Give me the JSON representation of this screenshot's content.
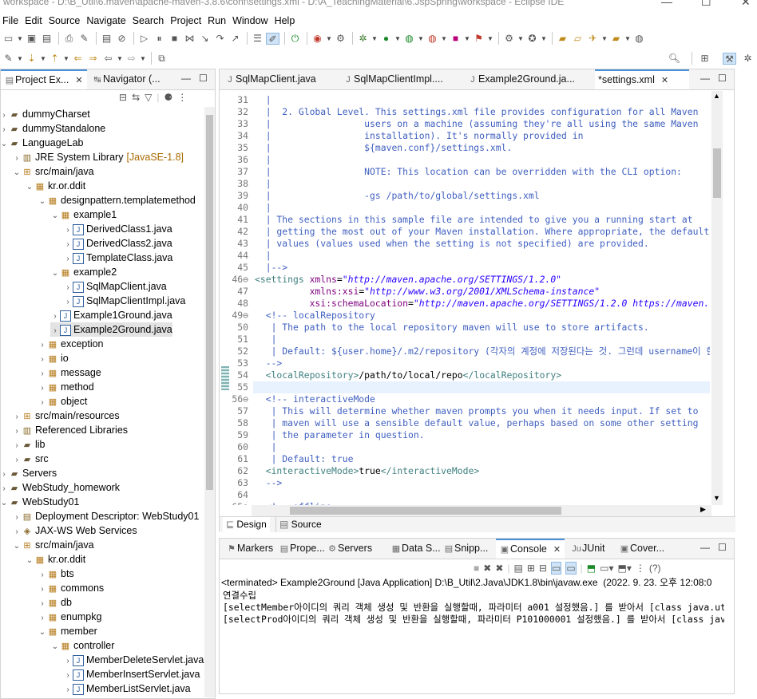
{
  "window": {
    "title": "workspace - D:\\B_Util\\6.maven\\apache-maven-3.8.6\\conf\\settings.xml - D:\\A_TeachingMaterial\\6.JspSpring\\workspace - Eclipse IDE"
  },
  "menu": [
    "File",
    "Edit",
    "Source",
    "Navigate",
    "Search",
    "Project",
    "Run",
    "Window",
    "Help"
  ],
  "left_tabs": [
    {
      "label": "Project Ex...",
      "close": "✕"
    },
    {
      "label": "Navigator (...",
      "close": ""
    }
  ],
  "tree": [
    {
      "label": "dummyCharset",
      "level": 0,
      "tw": "›",
      "icon": "folder",
      "kind": "proj"
    },
    {
      "label": "dummyStandalone",
      "level": 0,
      "tw": "›",
      "icon": "folder",
      "kind": "proj"
    },
    {
      "label": "LanguageLab",
      "level": 0,
      "tw": "⌄",
      "icon": "folder",
      "kind": "proj"
    },
    {
      "label": "JRE System Library",
      "decor": "[JavaSE-1.8]",
      "level": 1,
      "tw": "›",
      "icon": "lib",
      "kind": "lib"
    },
    {
      "label": "src/main/java",
      "level": 1,
      "tw": "⌄",
      "icon": "srcfolder",
      "kind": "pkg"
    },
    {
      "label": "kr.or.ddit",
      "level": 2,
      "tw": "⌄",
      "icon": "package",
      "kind": "pkg"
    },
    {
      "label": "designpattern.templatemethod",
      "level": 3,
      "tw": "⌄",
      "icon": "package",
      "kind": "pkg"
    },
    {
      "label": "example1",
      "level": 4,
      "tw": "⌄",
      "icon": "package",
      "kind": "pkg"
    },
    {
      "label": "DerivedClass1.java",
      "level": 5,
      "tw": "›",
      "icon": "java",
      "kind": "java"
    },
    {
      "label": "DerivedClass2.java",
      "level": 5,
      "tw": "›",
      "icon": "java",
      "kind": "java"
    },
    {
      "label": "TemplateClass.java",
      "level": 5,
      "tw": "›",
      "icon": "java",
      "kind": "java"
    },
    {
      "label": "example2",
      "level": 4,
      "tw": "⌄",
      "icon": "package",
      "kind": "pkg"
    },
    {
      "label": "SqlMapClient.java",
      "level": 5,
      "tw": "›",
      "icon": "java",
      "kind": "java"
    },
    {
      "label": "SqlMapClientImpl.java",
      "level": 5,
      "tw": "›",
      "icon": "java",
      "kind": "java"
    },
    {
      "label": "Example1Ground.java",
      "level": 4,
      "tw": "›",
      "icon": "java",
      "kind": "java"
    },
    {
      "label": "Example2Ground.java",
      "level": 4,
      "tw": "›",
      "icon": "java",
      "kind": "java",
      "selected": true
    },
    {
      "label": "exception",
      "level": 3,
      "tw": "›",
      "icon": "package",
      "kind": "pkg"
    },
    {
      "label": "io",
      "level": 3,
      "tw": "›",
      "icon": "package",
      "kind": "pkg"
    },
    {
      "label": "message",
      "level": 3,
      "tw": "›",
      "icon": "package",
      "kind": "pkg"
    },
    {
      "label": "method",
      "level": 3,
      "tw": "›",
      "icon": "package",
      "kind": "pkg"
    },
    {
      "label": "object",
      "level": 3,
      "tw": "›",
      "icon": "package",
      "kind": "pkg"
    },
    {
      "label": "src/main/resources",
      "level": 1,
      "tw": "›",
      "icon": "srcfolder",
      "kind": "pkg"
    },
    {
      "label": "Referenced Libraries",
      "level": 1,
      "tw": "›",
      "icon": "lib",
      "kind": "lib"
    },
    {
      "label": "lib",
      "level": 1,
      "tw": "›",
      "icon": "folder",
      "kind": "proj"
    },
    {
      "label": "src",
      "level": 1,
      "tw": "›",
      "icon": "folder",
      "kind": "proj"
    },
    {
      "label": "Servers",
      "level": 0,
      "tw": "›",
      "icon": "folder",
      "kind": "proj"
    },
    {
      "label": "WebStudy_homework",
      "level": 0,
      "tw": "›",
      "icon": "folder",
      "kind": "proj"
    },
    {
      "label": "WebStudy01",
      "level": 0,
      "tw": "⌄",
      "icon": "folder",
      "kind": "proj"
    },
    {
      "label": "Deployment Descriptor: WebStudy01",
      "level": 1,
      "tw": "›",
      "icon": "dd",
      "kind": "lib"
    },
    {
      "label": "JAX-WS Web Services",
      "level": 1,
      "tw": "›",
      "icon": "ws",
      "kind": "lib"
    },
    {
      "label": "src/main/java",
      "level": 1,
      "tw": "⌄",
      "icon": "srcfolder",
      "kind": "pkg"
    },
    {
      "label": "kr.or.ddit",
      "level": 2,
      "tw": "⌄",
      "icon": "package",
      "kind": "pkg"
    },
    {
      "label": "bts",
      "level": 3,
      "tw": "›",
      "icon": "package",
      "kind": "pkg"
    },
    {
      "label": "commons",
      "level": 3,
      "tw": "›",
      "icon": "package",
      "kind": "pkg"
    },
    {
      "label": "db",
      "level": 3,
      "tw": "›",
      "icon": "package",
      "kind": "pkg"
    },
    {
      "label": "enumpkg",
      "level": 3,
      "tw": "›",
      "icon": "package",
      "kind": "pkg"
    },
    {
      "label": "member",
      "level": 3,
      "tw": "⌄",
      "icon": "package",
      "kind": "pkg"
    },
    {
      "label": "controller",
      "level": 4,
      "tw": "⌄",
      "icon": "package",
      "kind": "pkg"
    },
    {
      "label": "MemberDeleteServlet.java",
      "level": 5,
      "tw": "›",
      "icon": "java",
      "kind": "java"
    },
    {
      "label": "MemberInsertServlet.java",
      "level": 5,
      "tw": "›",
      "icon": "java",
      "kind": "java"
    },
    {
      "label": "MemberListServlet.java",
      "level": 5,
      "tw": "›",
      "icon": "java",
      "kind": "java"
    }
  ],
  "editor_tabs": [
    {
      "label": "SqlMapClient.java",
      "active": false
    },
    {
      "label": "SqlMapClientImpl....",
      "active": false
    },
    {
      "label": "Example2Ground.ja...",
      "active": false
    },
    {
      "label": "*settings.xml",
      "active": true
    }
  ],
  "code_lines": [
    {
      "n": "31",
      "segs": [
        {
          "t": "  |",
          "c": "cm"
        }
      ]
    },
    {
      "n": "32",
      "segs": [
        {
          "t": "  |  2. Global Level. This settings.xml file provides configuration for all Maven",
          "c": "cm"
        }
      ]
    },
    {
      "n": "33",
      "segs": [
        {
          "t": "  |                 users on a machine (assuming they're all using the same Maven",
          "c": "cm"
        }
      ]
    },
    {
      "n": "34",
      "segs": [
        {
          "t": "  |                 installation). It's normally provided in",
          "c": "cm"
        }
      ]
    },
    {
      "n": "35",
      "segs": [
        {
          "t": "  |                 ${maven.conf}/settings.xml.",
          "c": "cm"
        }
      ]
    },
    {
      "n": "36",
      "segs": [
        {
          "t": "  |",
          "c": "cm"
        }
      ]
    },
    {
      "n": "37",
      "segs": [
        {
          "t": "  |                 NOTE: This location can be overridden with the CLI option:",
          "c": "cm"
        }
      ]
    },
    {
      "n": "38",
      "segs": [
        {
          "t": "  |",
          "c": "cm"
        }
      ]
    },
    {
      "n": "39",
      "segs": [
        {
          "t": "  |                 -gs /path/to/global/settings.xml",
          "c": "cm"
        }
      ]
    },
    {
      "n": "40",
      "segs": [
        {
          "t": "  |",
          "c": "cm"
        }
      ]
    },
    {
      "n": "41",
      "segs": [
        {
          "t": "  | The sections in this sample file are intended to give you a running start at",
          "c": "cm"
        }
      ]
    },
    {
      "n": "42",
      "segs": [
        {
          "t": "  | getting the most out of your Maven installation. Where appropriate, the default",
          "c": "cm"
        }
      ]
    },
    {
      "n": "43",
      "segs": [
        {
          "t": "  | values (values used when the setting is not specified) are provided.",
          "c": "cm"
        }
      ]
    },
    {
      "n": "44",
      "segs": [
        {
          "t": "  |",
          "c": "cm"
        }
      ]
    },
    {
      "n": "45",
      "segs": [
        {
          "t": "  |-->",
          "c": "cm"
        }
      ]
    },
    {
      "n": "46⊖",
      "segs": [
        {
          "t": "<settings ",
          "c": "tg"
        },
        {
          "t": "xmlns",
          "c": "at"
        },
        {
          "t": "=",
          "c": ""
        },
        {
          "t": "\"http://maven.apache.org/SETTINGS/1.2.0\"",
          "c": "av"
        }
      ]
    },
    {
      "n": "47",
      "segs": [
        {
          "t": "          ",
          "c": ""
        },
        {
          "t": "xmlns:xsi",
          "c": "at"
        },
        {
          "t": "=",
          "c": ""
        },
        {
          "t": "\"http://www.w3.org/2001/XMLSchema-instance\"",
          "c": "av"
        }
      ]
    },
    {
      "n": "48",
      "segs": [
        {
          "t": "          ",
          "c": ""
        },
        {
          "t": "xsi:schemaLocation",
          "c": "at"
        },
        {
          "t": "=",
          "c": ""
        },
        {
          "t": "\"http://maven.apache.org/SETTINGS/1.2.0 https://maven.",
          "c": "av"
        }
      ]
    },
    {
      "n": "49⊖",
      "segs": [
        {
          "t": "  <!-- localRepository",
          "c": "cm"
        }
      ]
    },
    {
      "n": "50",
      "segs": [
        {
          "t": "   | The path to the local repository maven will use to store artifacts.",
          "c": "cm"
        }
      ]
    },
    {
      "n": "51",
      "segs": [
        {
          "t": "   |",
          "c": "cm"
        }
      ]
    },
    {
      "n": "52",
      "segs": [
        {
          "t": "   | Default: ${user.home}/.m2/repository (각자의 계정에 저장된다는 것. 그런데 username이 한",
          "c": "cm"
        }
      ]
    },
    {
      "n": "53",
      "segs": [
        {
          "t": "  -->",
          "c": "cm"
        }
      ]
    },
    {
      "n": "54",
      "segs": [
        {
          "t": "  <localRepository>",
          "c": "tg"
        },
        {
          "t": "/path/to/local/repo",
          "c": ""
        },
        {
          "t": "</localRepository>",
          "c": "tg"
        }
      ]
    },
    {
      "n": "55",
      "segs": [
        {
          "t": "",
          "c": ""
        }
      ],
      "current": true
    },
    {
      "n": "56⊖",
      "segs": [
        {
          "t": "  <!-- interactiveMode",
          "c": "cm"
        }
      ]
    },
    {
      "n": "57",
      "segs": [
        {
          "t": "   | This will determine whether maven prompts you when it needs input. If set to",
          "c": "cm"
        }
      ]
    },
    {
      "n": "58",
      "segs": [
        {
          "t": "   | maven will use a sensible default value, perhaps based on some other setting",
          "c": "cm"
        }
      ]
    },
    {
      "n": "59",
      "segs": [
        {
          "t": "   | the parameter in question.",
          "c": "cm"
        }
      ]
    },
    {
      "n": "60",
      "segs": [
        {
          "t": "   |",
          "c": "cm"
        }
      ]
    },
    {
      "n": "61",
      "segs": [
        {
          "t": "   | Default: true",
          "c": "cm"
        }
      ]
    },
    {
      "n": "62",
      "segs": [
        {
          "t": "  <interactiveMode>",
          "c": "tg"
        },
        {
          "t": "true",
          "c": ""
        },
        {
          "t": "</interactiveMode>",
          "c": "tg"
        }
      ]
    },
    {
      "n": "63",
      "segs": [
        {
          "t": "  -->",
          "c": "cm"
        }
      ]
    },
    {
      "n": "64",
      "segs": [
        {
          "t": "",
          "c": ""
        }
      ]
    },
    {
      "n": "65⊖",
      "segs": [
        {
          "t": "  <!-- offline",
          "c": "cm"
        }
      ]
    }
  ],
  "design_tabs": {
    "design": "Design",
    "source": "Source"
  },
  "bottom_tabs": [
    {
      "label": "Markers",
      "active": false
    },
    {
      "label": "Prope...",
      "active": false
    },
    {
      "label": "Servers",
      "active": false
    },
    {
      "label": "Data S...",
      "active": false
    },
    {
      "label": "Snipp...",
      "active": false
    },
    {
      "label": "Console",
      "active": true
    },
    {
      "label": "JUnit",
      "active": false
    },
    {
      "label": "Cover...",
      "active": false
    }
  ],
  "console": {
    "terminated": "<terminated> Example2Ground [Java Application] D:\\B_Util\\2.Java\\JDK1.8\\bin\\javaw.exe  (2022. 9. 23. 오후 12:08:0",
    "lines": [
      "연결수립",
      "[selectMember아이디의 쿼리 객체 생성 및 반환을 실행할때, 파라미터 a001 설정했음.] 를 받아서 [class java.uti",
      "[selectProd아이디의 쿼리 객체 생성 및 반환을 실행할때, 파라미터 P101000001 설정했음.] 를 받아서 [class java"
    ]
  },
  "colors": {
    "accent": "#4a90d9",
    "selection": "#e3e3e3",
    "comment": "#3f5fbf",
    "tag": "#3f7f7f",
    "attr": "#7f007f",
    "value": "#2a00ff"
  }
}
